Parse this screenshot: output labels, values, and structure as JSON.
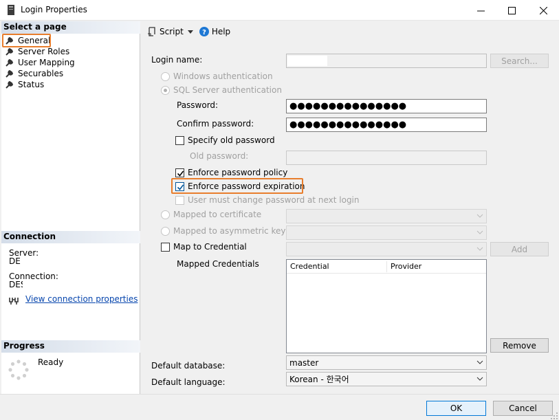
{
  "window": {
    "title": "Login Properties",
    "minimize": "—",
    "maximize": "☐",
    "close": "✕"
  },
  "left": {
    "select_page_header": "Select a page",
    "pages": [
      {
        "label": "General",
        "selected": true
      },
      {
        "label": "Server Roles"
      },
      {
        "label": "User Mapping"
      },
      {
        "label": "Securables"
      },
      {
        "label": "Status"
      }
    ],
    "connection_header": "Connection",
    "server_label": "Server:",
    "server_value": "DE",
    "connection_label": "Connection:",
    "connection_value": "DES",
    "view_connection_link": "View connection properties",
    "progress_header": "Progress",
    "progress_status": "Ready"
  },
  "toolbar": {
    "script_label": "Script",
    "help_label": "Help"
  },
  "form": {
    "login_name_label": "Login name:",
    "login_name_value": "",
    "search_button": "Search...",
    "windows_auth": "Windows authentication",
    "sql_auth": "SQL Server authentication",
    "password_label": "Password:",
    "password_value": "●●●●●●●●●●●●●●●",
    "confirm_password_label": "Confirm password:",
    "confirm_password_value": "●●●●●●●●●●●●●●●",
    "specify_old_password": "Specify old password",
    "old_password_label": "Old password:",
    "enforce_policy": "Enforce password policy",
    "enforce_expiration": "Enforce password expiration",
    "must_change": "User must change password at next login",
    "mapped_certificate": "Mapped to certificate",
    "mapped_asym_key": "Mapped to asymmetric key",
    "map_credential": "Map to Credential",
    "add_button": "Add",
    "mapped_credentials_label": "Mapped Credentials",
    "cred_columns": [
      "Credential",
      "Provider"
    ],
    "remove_button": "Remove",
    "default_database_label": "Default database:",
    "default_database_value": "master",
    "default_language_label": "Default language:",
    "default_language_value": "Korean - 한국어"
  },
  "buttons": {
    "ok": "OK",
    "cancel": "Cancel"
  },
  "colors": {
    "highlight_orange": "#e87d2c",
    "link_blue": "#0645ad",
    "header_gradient": "#d4dde9"
  }
}
